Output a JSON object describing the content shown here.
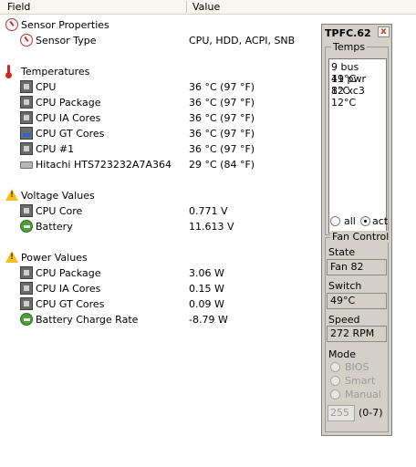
{
  "header": {
    "field": "Field",
    "value": "Value"
  },
  "tree": {
    "sensor_properties": {
      "label": "Sensor Properties",
      "sensor_type": {
        "label": "Sensor Type",
        "value": "CPU, HDD, ACPI, SNB"
      }
    },
    "temperatures": {
      "label": "Temperatures",
      "items": [
        {
          "label": "CPU",
          "value": "36 °C  (97 °F)"
        },
        {
          "label": "CPU Package",
          "value": "36 °C  (97 °F)"
        },
        {
          "label": "CPU IA Cores",
          "value": "36 °C  (97 °F)"
        },
        {
          "label": "CPU GT Cores",
          "value": "36 °C  (97 °F)"
        },
        {
          "label": "CPU #1",
          "value": "36 °C  (97 °F)"
        },
        {
          "label": "Hitachi HTS723232A7A364",
          "value": "29 °C  (84 °F)"
        }
      ]
    },
    "voltage": {
      "label": "Voltage Values",
      "items": [
        {
          "label": "CPU Core",
          "value": "0.771 V"
        },
        {
          "label": "Battery",
          "value": "11.613 V"
        }
      ]
    },
    "power": {
      "label": "Power Values",
      "items": [
        {
          "label": "CPU Package",
          "value": "3.06 W"
        },
        {
          "label": "CPU IA Cores",
          "value": "0.15 W"
        },
        {
          "label": "CPU GT Cores",
          "value": "0.09 W"
        },
        {
          "label": "Battery Charge Rate",
          "value": "-8.79 W"
        }
      ]
    }
  },
  "tpfc": {
    "title": "TPFC.62",
    "close": "x",
    "temps_label": "Temps",
    "temps_lines": [
      "9 bus 49°C",
      "11 pwr 8°C",
      "12 xc3 12°C"
    ],
    "all_label": "all",
    "act_label": "act",
    "fan_control_label": "Fan Control",
    "state_label": "State",
    "state_value": "Fan 82",
    "switch_label": "Switch",
    "switch_value": "49°C",
    "speed_label": "Speed",
    "speed_value": "272 RPM",
    "mode_label": "Mode",
    "mode_bios": "BIOS",
    "mode_smart": "Smart",
    "mode_manual": "Manual",
    "manual_value": "255",
    "manual_range": "(0-7)"
  },
  "colors": {
    "panel_bg": "#d4d0c8",
    "header_bg": "#f7f6f1"
  }
}
